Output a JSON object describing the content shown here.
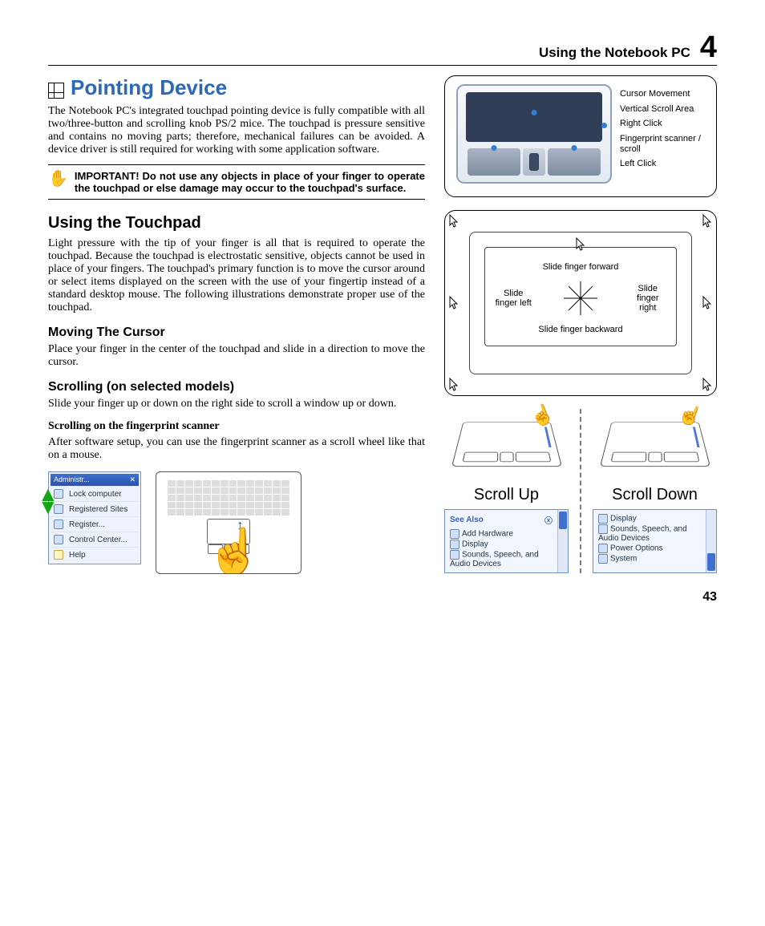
{
  "header": {
    "title": "Using the Notebook PC",
    "chapter": "4"
  },
  "section": {
    "title": "Pointing Device",
    "intro": "The Notebook PC's integrated touchpad pointing device is fully compatible with all two/three-button and scrolling knob PS/2 mice. The touchpad is pressure sensitive and contains no moving parts; therefore, mechanical failures can be avoided. A device driver is still required for working with some application software.",
    "important": "IMPORTANT! Do not use any objects in place of your finger to operate the touchpad or else damage may occur to the touchpad's surface.",
    "using_title": "Using the Touchpad",
    "using_body": "Light pressure with the tip of your finger is all that is required to operate the touchpad. Because the touchpad is electrostatic sensitive, objects cannot be used in place of your fingers. The touchpad's primary function is to move the cursor around or select items displayed on the screen with the use of your fingertip instead of a standard desktop mouse. The following illustrations demonstrate proper use of the touchpad.",
    "moving_title": "Moving The Cursor",
    "moving_body": "Place your finger in the center of the touchpad and slide in a direction to move the cursor.",
    "scroll_title": "Scrolling (on selected models)",
    "scroll_body": "Slide your finger up or down on the right side to scroll a window up or down.",
    "fp_title": "Scrolling on the fingerprint scanner",
    "fp_body": "After software setup, you can use the fingerprint scanner as a scroll wheel like that on a mouse."
  },
  "diagram1": {
    "labels": {
      "cursor": "Cursor Movement",
      "vscroll": "Vertical Scroll Area",
      "right": "Right Click",
      "fp": "Fingerprint scanner / scroll",
      "left": "Left Click"
    }
  },
  "diagram2": {
    "forward": "Slide finger forward",
    "left": "Slide finger left",
    "right": "Slide finger right",
    "backward": "Slide finger backward"
  },
  "scroll": {
    "up": "Scroll Up",
    "down": "Scroll Down",
    "panel_left": {
      "header": "See Also",
      "items": [
        "Add Hardware",
        "Display",
        "Sounds, Speech, and Audio Devices"
      ]
    },
    "panel_right": {
      "items": [
        "Display",
        "Sounds, Speech, and Audio Devices",
        "Power Options",
        "System"
      ]
    }
  },
  "xp_menu": {
    "title": "Administr...",
    "items": [
      "Lock computer",
      "Registered Sites",
      "Register...",
      "Control Center...",
      "Help"
    ]
  },
  "page": "43"
}
